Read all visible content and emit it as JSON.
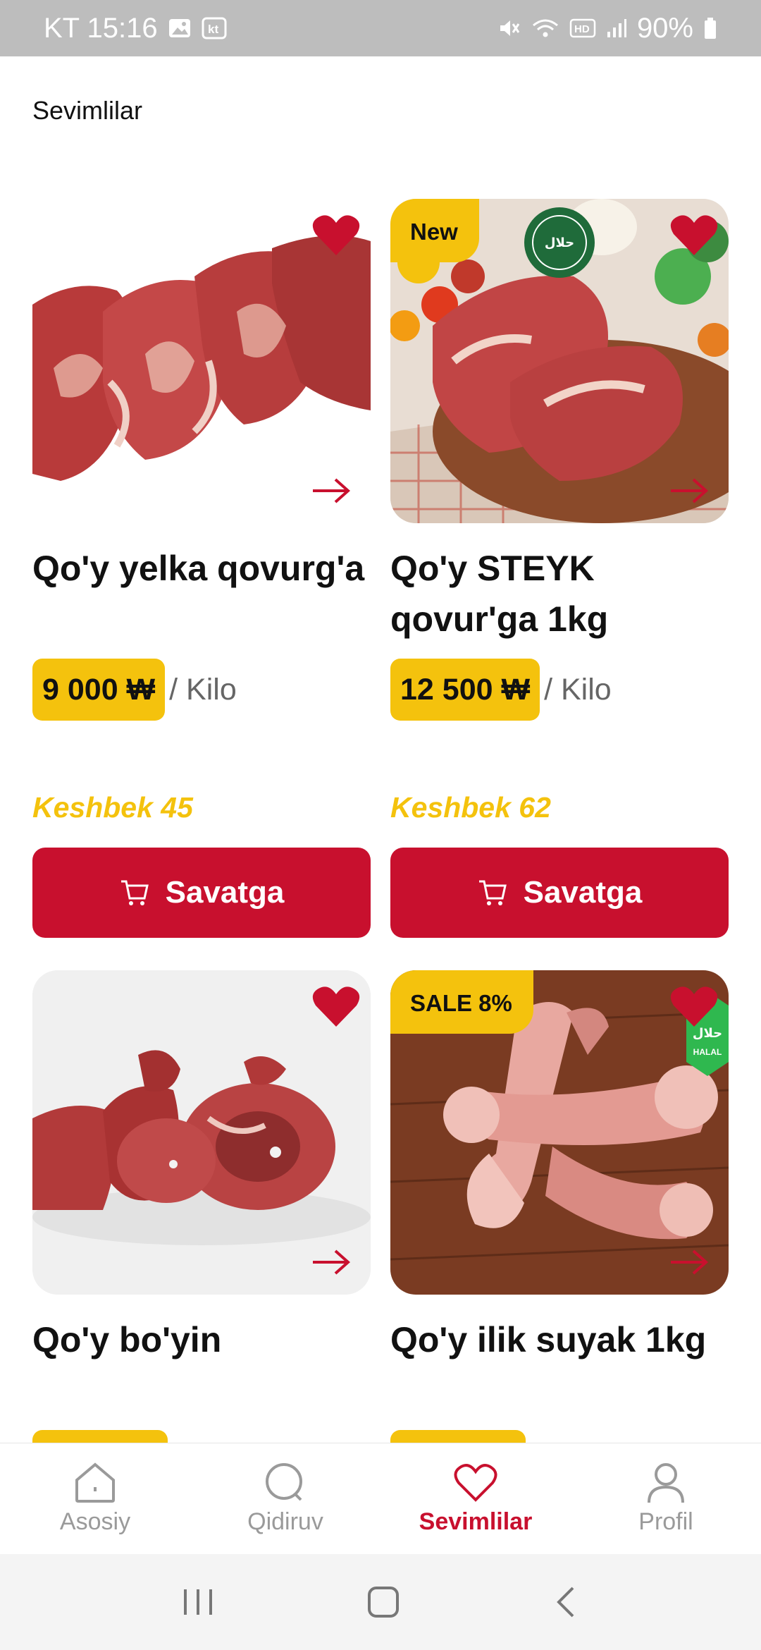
{
  "status_bar": {
    "carrier_time": "KT 15:16",
    "battery": "90%",
    "icons": [
      "gallery-icon",
      "kt-app-icon",
      "mute-icon",
      "wifi-icon",
      "hd-icon",
      "signal-icon",
      "battery-icon"
    ]
  },
  "page": {
    "title": "Sevimlilar"
  },
  "colors": {
    "accent": "#c8102e",
    "highlight": "#f4c20d",
    "muted": "#9a9a9a"
  },
  "products": [
    {
      "name": "Qo'y yelka qovurg'a",
      "badge": "",
      "price": "9 000 ₩",
      "unit": "/ Kilo",
      "cashback": "Keshbek 45",
      "cart_label": "Savatga",
      "favorite": true
    },
    {
      "name": "Qo'y STEYK qovur'ga 1kg",
      "badge": "New",
      "price": "12 500 ₩",
      "unit": "/ Kilo",
      "cashback": "Keshbek 62",
      "cart_label": "Savatga",
      "favorite": true
    },
    {
      "name": "Qo'y bo'yin",
      "badge": "",
      "favorite": true
    },
    {
      "name": "Qo'y ilik suyak 1kg",
      "badge": "SALE 8%",
      "favorite": true
    }
  ],
  "bottom_nav": [
    {
      "label": "Asosiy",
      "icon": "home-icon",
      "active": false
    },
    {
      "label": "Qidiruv",
      "icon": "search-icon",
      "active": false
    },
    {
      "label": "Sevimlilar",
      "icon": "heart-icon",
      "active": true
    },
    {
      "label": "Profil",
      "icon": "profile-icon",
      "active": false
    }
  ]
}
